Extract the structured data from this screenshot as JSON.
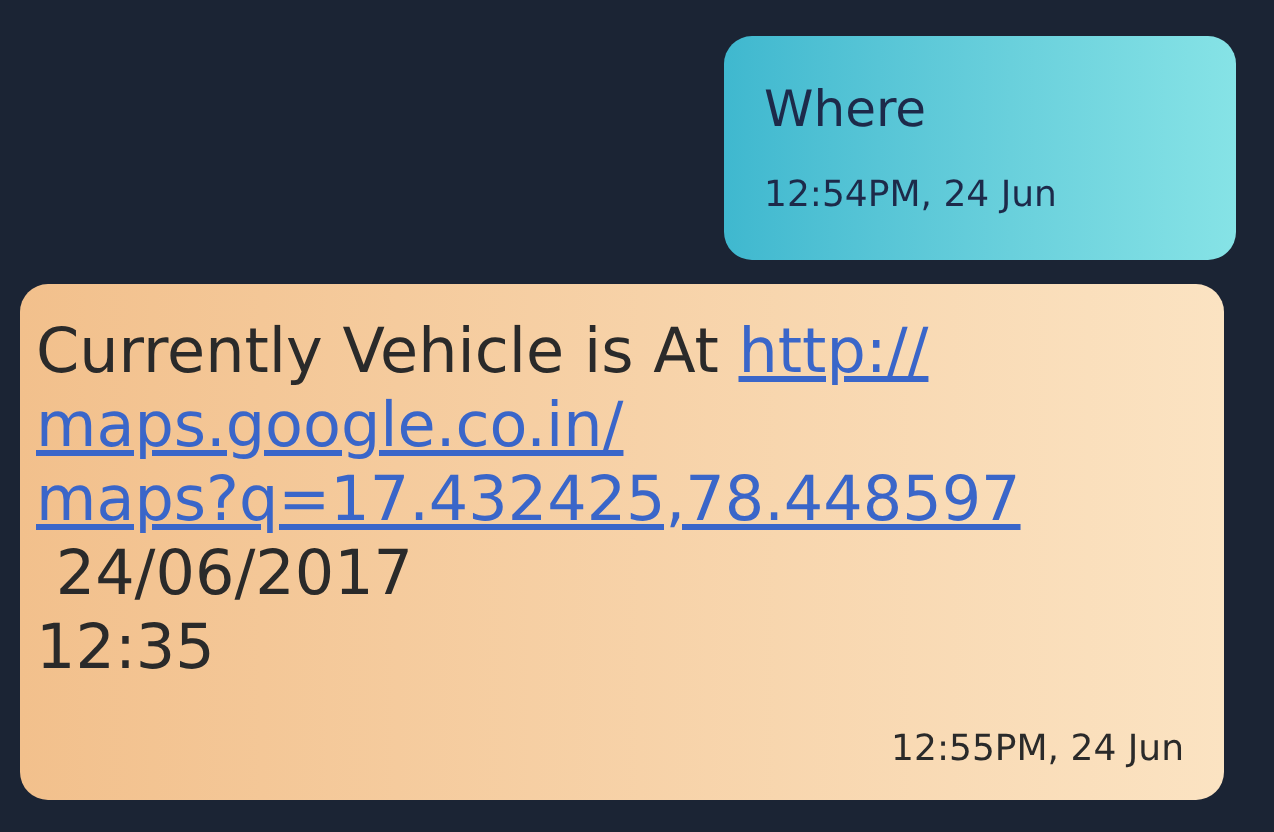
{
  "messages": [
    {
      "kind": "outgoing",
      "text": "Where",
      "time": "12:54PM, 24 Jun"
    },
    {
      "kind": "incoming",
      "text": "Currently Vehicle is At ",
      "link_lines": [
        "http://",
        "maps.google.co.in/",
        "maps?q=17.432425,78.448597"
      ],
      "lines": [
        " 24/06/2017",
        "12:35"
      ],
      "time": "12:55PM, 24 Jun"
    }
  ]
}
